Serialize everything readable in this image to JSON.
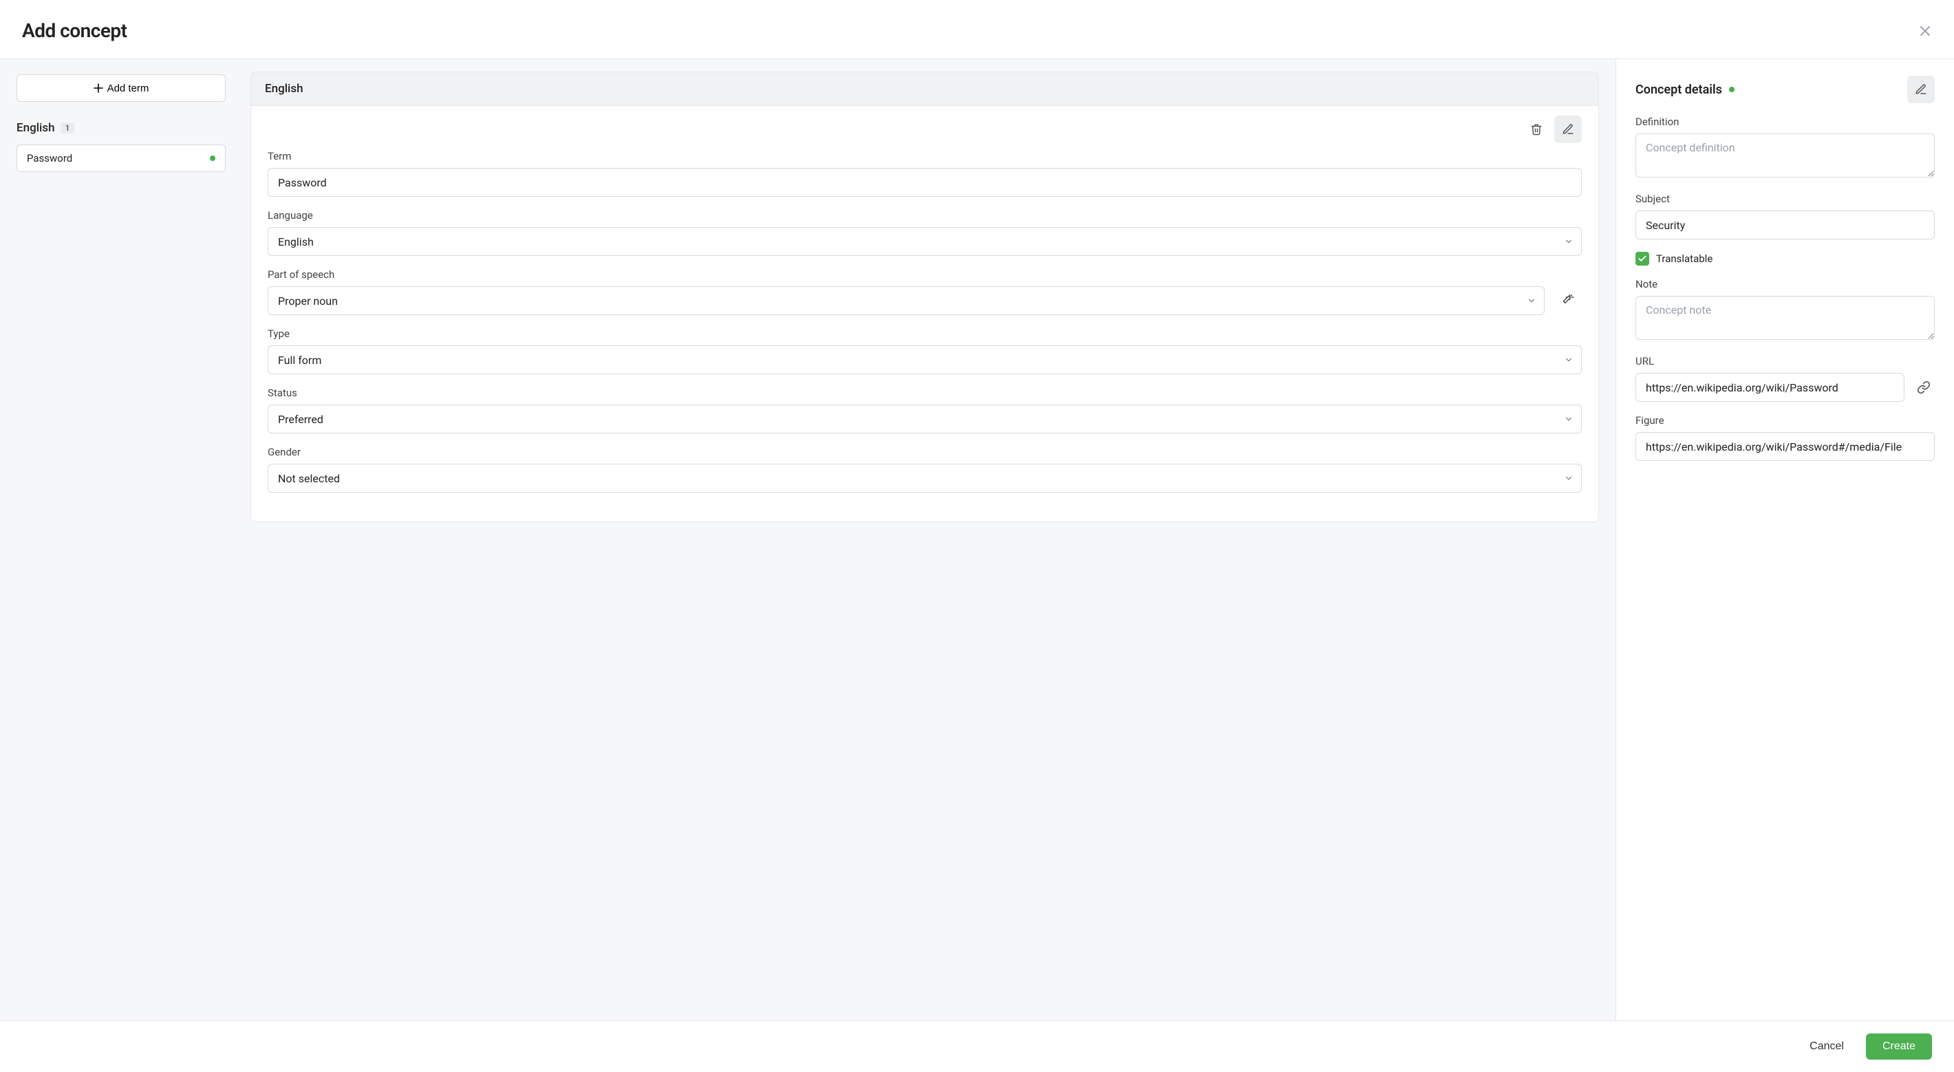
{
  "header": {
    "title": "Add concept"
  },
  "sidebar": {
    "add_term_label": "Add term",
    "language_group": "English",
    "language_count": "1",
    "term_item": "Password"
  },
  "editor": {
    "language_header": "English",
    "fields": {
      "term_label": "Term",
      "term_value": "Password",
      "language_label": "Language",
      "language_value": "English",
      "pos_label": "Part of speech",
      "pos_value": "Proper noun",
      "type_label": "Type",
      "type_value": "Full form",
      "status_label": "Status",
      "status_value": "Preferred",
      "gender_label": "Gender",
      "gender_value": "Not selected"
    }
  },
  "details": {
    "title": "Concept details",
    "definition_label": "Definition",
    "definition_placeholder": "Concept definition",
    "subject_label": "Subject",
    "subject_value": "Security",
    "translatable_label": "Translatable",
    "translatable_checked": true,
    "note_label": "Note",
    "note_placeholder": "Concept note",
    "url_label": "URL",
    "url_value": "https://en.wikipedia.org/wiki/Password",
    "figure_label": "Figure",
    "figure_value": "https://en.wikipedia.org/wiki/Password#/media/File"
  },
  "footer": {
    "cancel_label": "Cancel",
    "create_label": "Create"
  }
}
